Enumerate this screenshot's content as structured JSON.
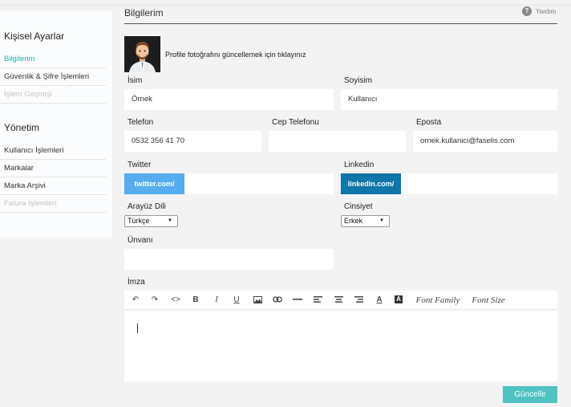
{
  "sidebar": {
    "section1_title": "Kişisel Ayarlar",
    "section1_items": [
      "Bilgilerim",
      "Güvenlik & Şifre İşlemleri",
      "İşlem Geçmişi"
    ],
    "section2_title": "Yönetim",
    "section2_items": [
      "Kullanıcı İşlemleri",
      "Markalar",
      "Marka Arşivi",
      "Fatura İşlemleri"
    ]
  },
  "header": {
    "title": "Bilgilerim",
    "help_label": "Yardım",
    "help_icon": "?"
  },
  "profile": {
    "photo_text": "Profile fotoğrafını güncellemek için tıklayınız"
  },
  "form": {
    "first_name_label": "İsim",
    "first_name_value": "Örnek",
    "last_name_label": "Soyisim",
    "last_name_value": "Kullanıcı",
    "phone_label": "Telefon",
    "phone_value": "0532 356 41 70",
    "mobile_label": "Cep Telefonu",
    "mobile_value": "",
    "email_label": "Eposta",
    "email_value": "ornek.kullanici@faselis.com",
    "twitter_label": "Twitter",
    "twitter_prefix": "twitter.com/",
    "twitter_value": "",
    "linkedin_label": "Linkedin",
    "linkedin_prefix": "linkedin.com/",
    "linkedin_value": "",
    "language_label": "Arayüz Dili",
    "language_value": "Türkçe",
    "gender_label": "Cinsiyet",
    "gender_value": "Erkek",
    "title_label": "Ünvanı",
    "title_value": "",
    "signature_label": "İmza"
  },
  "editor": {
    "toolbar": {
      "undo": "↶",
      "redo": "↷",
      "code": "<>",
      "bold": "B",
      "italic": "I",
      "underline": "U",
      "image": "",
      "link": "",
      "hr": "",
      "align_left": "",
      "align_center": "",
      "align_right": "",
      "font_color": "A",
      "bg_color": "A",
      "font_family": "Font Family",
      "font_size": "Font Size"
    }
  },
  "actions": {
    "update_label": "Güncelle"
  },
  "colors": {
    "accent": "#2bb5b0",
    "twitter": "#55acee",
    "linkedin": "#0e76a8",
    "button": "#4fc3c1"
  }
}
